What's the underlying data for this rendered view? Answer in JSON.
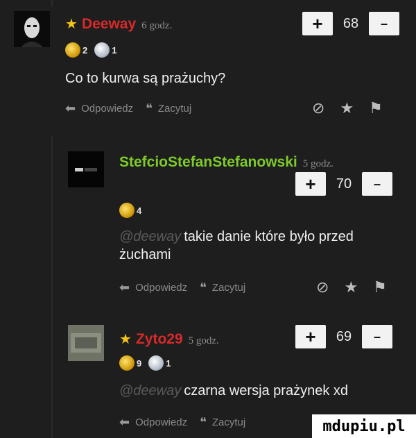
{
  "comments": [
    {
      "author": "Deeway",
      "starred": true,
      "time": "6 godz.",
      "score": "68",
      "badges": [
        {
          "type": "gold",
          "count": "2"
        },
        {
          "type": "silver",
          "count": "1"
        }
      ],
      "mention": "",
      "text": "Co to kurwa są prażuchy?",
      "reply_label": "Odpowiedz",
      "quote_label": "Zacytuj"
    },
    {
      "author": "StefcioStefanStefanowski",
      "starred": false,
      "time": "5 godz.",
      "score": "70",
      "badges": [
        {
          "type": "gold",
          "count": "4"
        }
      ],
      "mention": "@deeway",
      "text": "takie danie które było przed żuchami",
      "reply_label": "Odpowiedz",
      "quote_label": "Zacytuj"
    },
    {
      "author": "Zyto29",
      "starred": true,
      "time": "5 godz.",
      "score": "69",
      "badges": [
        {
          "type": "gold",
          "count": "9"
        },
        {
          "type": "silver",
          "count": "1"
        }
      ],
      "mention": "@deeway",
      "text": "czarna wersja prażynek xd",
      "reply_label": "Odpowiedz",
      "quote_label": "Zacytuj"
    }
  ],
  "vote": {
    "plus": "+",
    "minus": "–"
  },
  "icons": {
    "reply": "reply-arrow-icon",
    "quote": "quote-icon",
    "star": "star-icon",
    "flag": "flag-icon",
    "ban": "block-icon"
  },
  "colors": {
    "author_red": "#d62a2a",
    "author_green": "#7ecb2a",
    "star": "#f5c518"
  },
  "watermark": "mdupiu.pl"
}
